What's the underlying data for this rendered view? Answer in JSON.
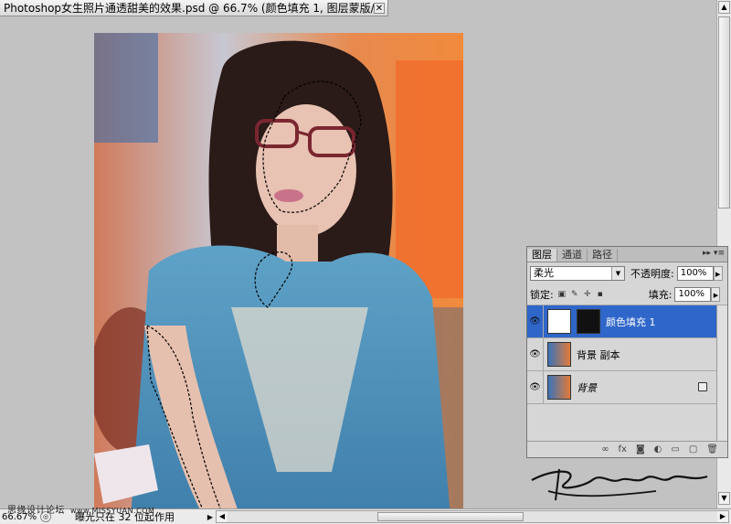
{
  "document_tab": {
    "title": "Photoshop女生照片通透甜美的效果.psd @ 66.7% (颜色填充 1, 图层蒙版/8) *",
    "close_glyph": "✕"
  },
  "statusbar": {
    "zoom": "66.67%",
    "info": "曝光只在 32 位起作用",
    "watermark": "思缘设计论坛",
    "watermark_url": "www.MISSYUAN.COM"
  },
  "layers_panel": {
    "tabs": [
      "图层",
      "通道",
      "路径"
    ],
    "blend_mode": "柔光",
    "opacity_label": "不透明度:",
    "opacity": "100%",
    "lock_label": "锁定:",
    "fill_label": "填充:",
    "fill": "100%",
    "layers": [
      {
        "name": "颜色填充 1",
        "selected": true,
        "visible": true
      },
      {
        "name": "背景 副本",
        "selected": false,
        "visible": true
      },
      {
        "name": "背景",
        "selected": false,
        "visible": true,
        "locked": true
      }
    ],
    "bottom_icons": [
      "link-icon",
      "fx-icon",
      "mask-icon",
      "adjustment-icon",
      "group-icon",
      "new-layer-icon",
      "trash-icon"
    ]
  },
  "signature": "Huoshanrizuo",
  "colors": {
    "selected_layer": "#2f66c9",
    "workspace_bg": "#c2c2c2"
  }
}
